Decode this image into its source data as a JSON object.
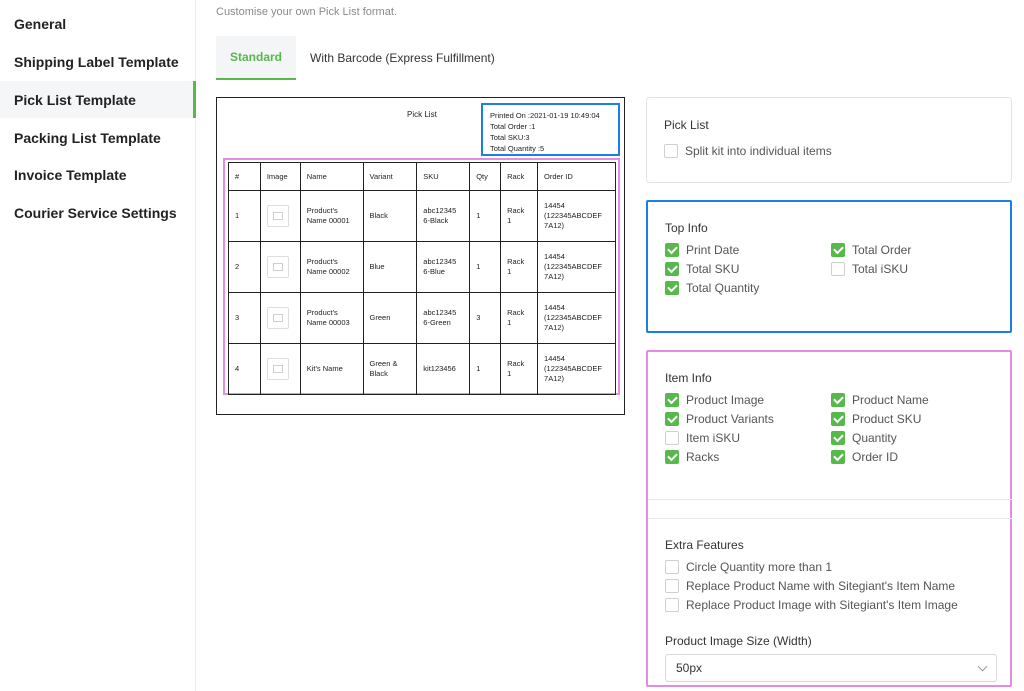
{
  "sidebar": {
    "items": [
      {
        "label": "General"
      },
      {
        "label": "Shipping Label Template"
      },
      {
        "label": "Pick List Template"
      },
      {
        "label": "Packing List Template"
      },
      {
        "label": "Invoice Template"
      },
      {
        "label": "Courier Service Settings"
      }
    ],
    "active_index": 2
  },
  "main": {
    "subtitle": "Customise your own Pick List format.",
    "tabs": [
      {
        "label": "Standard"
      },
      {
        "label": "With Barcode (Express Fulfillment)"
      }
    ]
  },
  "preview": {
    "title": "Pick List",
    "top_info": {
      "printed_on": "Printed On :2021-01-19 10:49:04",
      "total_order": "Total Order :1",
      "total_sku": "Total SKU:3",
      "total_quantity": "Total Quantity :5"
    },
    "headers": [
      "#",
      "Image",
      "Name",
      "Variant",
      "SKU",
      "Qty",
      "Rack",
      "Order ID"
    ],
    "rows": [
      {
        "num": "1",
        "name_line1": "Product's",
        "name_line2": "Name 00001",
        "variant_line1": "Black",
        "variant_line2": "",
        "sku_line1": "abc12345",
        "sku_line2": "6-Black",
        "qty": "1",
        "rack_line1": "Rack",
        "rack_line2": "1",
        "order_line1": "14454",
        "order_line2": "(122345ABCDEF",
        "order_line3": "7A12)"
      },
      {
        "num": "2",
        "name_line1": "Product's",
        "name_line2": "Name 00002",
        "variant_line1": "Blue",
        "variant_line2": "",
        "sku_line1": "abc12345",
        "sku_line2": "6-Blue",
        "qty": "1",
        "rack_line1": "Rack",
        "rack_line2": "1",
        "order_line1": "14454",
        "order_line2": "(122345ABCDEF",
        "order_line3": "7A12)"
      },
      {
        "num": "3",
        "name_line1": "Product's",
        "name_line2": "Name 00003",
        "variant_line1": "Green",
        "variant_line2": "",
        "sku_line1": "abc12345",
        "sku_line2": "6-Green",
        "qty": "3",
        "rack_line1": "Rack",
        "rack_line2": "1",
        "order_line1": "14454",
        "order_line2": "(122345ABCDEF",
        "order_line3": "7A12)"
      },
      {
        "num": "4",
        "name_line1": "Kit's Name",
        "name_line2": "",
        "variant_line1": "Green &",
        "variant_line2": "Black",
        "sku_line1": "kit123456",
        "sku_line2": "",
        "qty": "1",
        "rack_line1": "Rack",
        "rack_line2": "1",
        "order_line1": "14454",
        "order_line2": "(122345ABCDEF",
        "order_line3": "7A12)"
      }
    ]
  },
  "settings": {
    "pick_list": {
      "title": "Pick List",
      "options": [
        {
          "label": "Split kit into individual items",
          "checked": false
        }
      ]
    },
    "top_info": {
      "title": "Top Info",
      "options": [
        {
          "label": "Print Date",
          "checked": true
        },
        {
          "label": "Total Order",
          "checked": true
        },
        {
          "label": "Total SKU",
          "checked": true
        },
        {
          "label": "Total iSKU",
          "checked": false
        },
        {
          "label": "Total Quantity",
          "checked": true
        }
      ]
    },
    "item_info": {
      "title": "Item Info",
      "options": [
        {
          "label": "Product Image",
          "checked": true
        },
        {
          "label": "Product Name",
          "checked": true
        },
        {
          "label": "Product Variants",
          "checked": true
        },
        {
          "label": "Product SKU",
          "checked": true
        },
        {
          "label": "Item iSKU",
          "checked": false
        },
        {
          "label": "Quantity",
          "checked": true
        },
        {
          "label": "Racks",
          "checked": true
        },
        {
          "label": "Order ID",
          "checked": true
        }
      ]
    },
    "extra": {
      "title": "Extra Features",
      "options": [
        {
          "label": "Circle Quantity more than 1",
          "checked": false
        },
        {
          "label": "Replace Product Name with Sitegiant's Item Name",
          "checked": false
        },
        {
          "label": "Replace Product Image with Sitegiant's Item Image",
          "checked": false
        }
      ],
      "image_size_label": "Product Image Size (Width)",
      "image_size_value": "50px"
    }
  },
  "colors": {
    "accent": "#57b94c",
    "top_info_highlight": "#1d7fe6",
    "item_info_highlight": "#e48be4"
  }
}
